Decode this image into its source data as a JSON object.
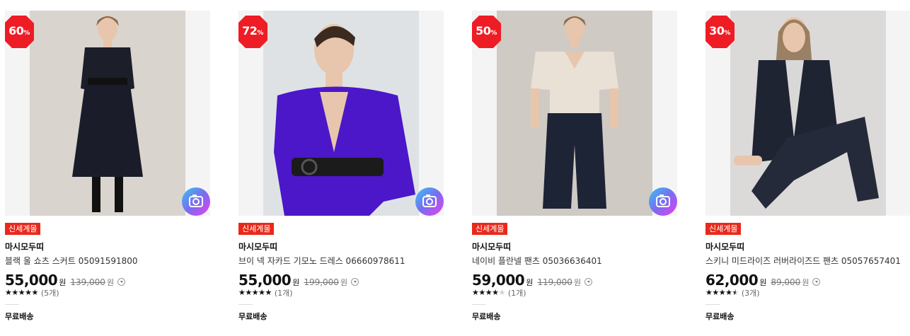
{
  "products": [
    {
      "discount": "60",
      "discount_unit": "%",
      "badge": "신세계몰",
      "brand": "마시모두띠",
      "name": "블랙 울 쇼츠 스커트 05091591800",
      "price": "55,000",
      "currency": "원",
      "original_price": "139,000",
      "rating_stars": 5,
      "review_count": "(5개)",
      "shipping": "무료배송",
      "has_camera_icon": true,
      "photo_desc": "model in black turtleneck and wide culottes",
      "top_color": "#1c1f2a",
      "bottom_color": "#1a1d29",
      "photo_bg": "#d9d4ce"
    },
    {
      "discount": "72",
      "discount_unit": "%",
      "badge": "신세계몰",
      "brand": "마시모두띠",
      "name": "브이 넥 자카드 기모노 드레스 06660978611",
      "price": "55,000",
      "currency": "원",
      "original_price": "199,000",
      "rating_stars": 5,
      "review_count": "(1개)",
      "shipping": "무료배송",
      "has_camera_icon": true,
      "photo_desc": "model in purple satin kimono dress",
      "top_color": "#4b17c9",
      "bottom_color": "#3e12b0",
      "photo_bg": "#dfe2e4"
    },
    {
      "discount": "50",
      "discount_unit": "%",
      "badge": "신세계몰",
      "brand": "마시모두띠",
      "name": "네이비 플란넬 팬츠 05036636401",
      "price": "59,000",
      "currency": "원",
      "original_price": "119,000",
      "rating_stars": 4,
      "review_count": "(1개)",
      "shipping": "무료배송",
      "has_camera_icon": true,
      "photo_desc": "model in beige knit top and navy pants",
      "top_color": "#e9e1d6",
      "bottom_color": "#1d2436",
      "photo_bg": "#cfcac4"
    },
    {
      "discount": "30",
      "discount_unit": "%",
      "badge": "신세계몰",
      "brand": "마시모두띠",
      "name": "스키니 미드라이즈 러버라이즈드 팬츠 05057657401",
      "price": "62,000",
      "currency": "원",
      "original_price": "89,000",
      "rating_stars": 4.5,
      "review_count": "(3개)",
      "shipping": "무료배송",
      "has_camera_icon": false,
      "photo_desc": "model in navy blazer and dark pants seated",
      "top_color": "#1f2433",
      "bottom_color": "#252a3a",
      "photo_bg": "#dcdad8"
    }
  ],
  "colors": {
    "discount_badge": "#ee1c24",
    "mall_badge": "#e8291c",
    "camera_gradient_start": "#4fc3f7",
    "camera_gradient_end": "#e040fb"
  }
}
